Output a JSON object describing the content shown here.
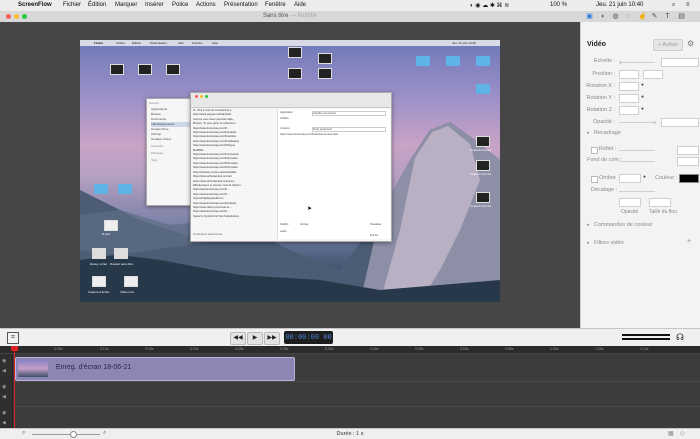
{
  "menubar": {
    "app_name": "ScreenFlow",
    "items": [
      "Fichier",
      "Édition",
      "Marquer",
      "Insérer",
      "Police",
      "Actions",
      "Présentation",
      "Fenêtre",
      "Aide"
    ],
    "battery": "100 %",
    "clock": "Jeu. 21 juin  10:40"
  },
  "window": {
    "title": "Sans titre",
    "subtitle": "Modifié"
  },
  "desktop": {
    "menubar_items": [
      "Finder",
      "Fichier",
      "Édition",
      "Présentation",
      "Aller",
      "Fenêtre",
      "Aide"
    ],
    "menubar_clock": "Jeu. 21 juin  10:38",
    "labels": [
      "Capture d'écran",
      "Capture d'écran",
      "Capture d'écran",
      "lit.psd",
      "Enreg. écran",
      "Dossier sans titre",
      "Capture d'écran",
      "Vidéo.mov"
    ],
    "finder": {
      "sidebar_title": "Favoris",
      "sidebar_items": [
        "Applications",
        "Bureau",
        "Documents",
        "Téléchargements",
        "Google Drive",
        "AirDrop",
        "Creative Cloud"
      ],
      "sidebar_section2": "Appareils",
      "sidebar_section3": "Partagés",
      "sidebar_section4": "Tags",
      "list_rows": [
        "Dr. offre 3 mois de membership p...",
        "https://www.paypal.me/drdentistrt",
        "Gomme vous l'avez peut-être déjà...",
        "Bonjour, Tu peux gérer ton abonnem...",
        "https://www.lemonway.com/fr/...",
        "https://www.lemonway.com/fr/podcast",
        "https://www.lemonway.com/fr/webinar",
        "https://www.lemonway.com/fr/marketing...",
        "https://www.lemonway.com/fr/blogue",
        "Ma4Bitlu!",
        "https://www.lemonway.com/fr/connexion",
        "https://www.lemonway.com/fr/formation",
        "https://www.lemonway.com/fr/formation",
        "https://www.lemonway.com/fr/formation",
        "https://sharerly.com/a-marche/details/...",
        "https://www.arthurlambert.com/art",
        "https://www.arthurlambert.com/enre...",
        "Effectivement, le premier mois de l'abonn...",
        "https://www.lemonway.com/fr/...",
        "https://www.lemonway.com/fr/...",
        "reponsefr@3byeaudiocom",
        "https://www.lemonway.com/fr/podcast",
        "https://www.udemy.com/matt-et-...",
        "https://www.lemonway.com/fr/...",
        "System's Symbol And Text Substitutions"
      ],
      "footer": "29 éléments sélectionnés",
      "detail_label_1": "Application",
      "detail_value_1": "Accéder à la source",
      "detail_label_2": "Contenu",
      "detail_value_2": "Texte seulement",
      "detail_link": "https://www.lemonway.com/fr/webinar-anniversaire",
      "detail_btn": "Visualiser",
      "detail_fields": [
        "Indéfini",
        "Format"
      ],
      "label_field": "Label",
      "size": "110 Ko"
    }
  },
  "inspector": {
    "toolbar_icons": [
      "video-settings-icon",
      "audio-settings-icon",
      "screen-recording-icon",
      "callout-icon",
      "touch-callout-icon",
      "annotations-icon",
      "text-box-icon",
      "media-library-icon"
    ],
    "panel_title": "Vidéo",
    "action_button": "+ Action",
    "gear_icon": "gear-icon",
    "rows": [
      {
        "label": "Échelle :"
      },
      {
        "label": "Position :"
      },
      {
        "label": "Rotation X :"
      },
      {
        "label": "Rotation Y :"
      },
      {
        "label": "Rotation Z :"
      },
      {
        "label": "Opacité :"
      }
    ],
    "section_cropping": "Recadrage",
    "reflect_label": "Reflet :",
    "edges_label": "Fond de coin :",
    "shadow_label": "Ombre",
    "color_label": "Couleur :",
    "offset_label": "Décalage :",
    "opacity_label": "Opacité",
    "blur_label": "Taille du flou",
    "section_color": "Commandes de couleur",
    "section_filters": "Filtres vidéo"
  },
  "transport": {
    "rewind_label": "◀◀",
    "play_label": "▶",
    "forward_label": "▶▶",
    "timecode": "00:00:00 00",
    "crop_icon": "crop-icon",
    "volume_icon": "volume-meter-icon",
    "headphones_icon": "headphones-icon"
  },
  "timeline": {
    "ruler_ticks": [
      "0:00s",
      "0:05s",
      "0:10s",
      "0:15s",
      "0:20s",
      "0:25s",
      "0:30s",
      "0:35s",
      "0:40s",
      "0:45s",
      "0:50s",
      "0:55s",
      "1:00s",
      "1:05s",
      "1:10s"
    ],
    "clip_label": "Enreg. d'écran 18-06-21"
  },
  "statusbar": {
    "duration": "Durée : 1 s",
    "zoom_out_icon": "zoom-out-icon",
    "zoom_in_icon": "zoom-in-icon",
    "zoom_level": 0.6
  },
  "colors": {
    "accent": "#e02020",
    "timecode": "#4a80d8",
    "clip": "#8d86b5",
    "folder": "#5fb3e6"
  }
}
